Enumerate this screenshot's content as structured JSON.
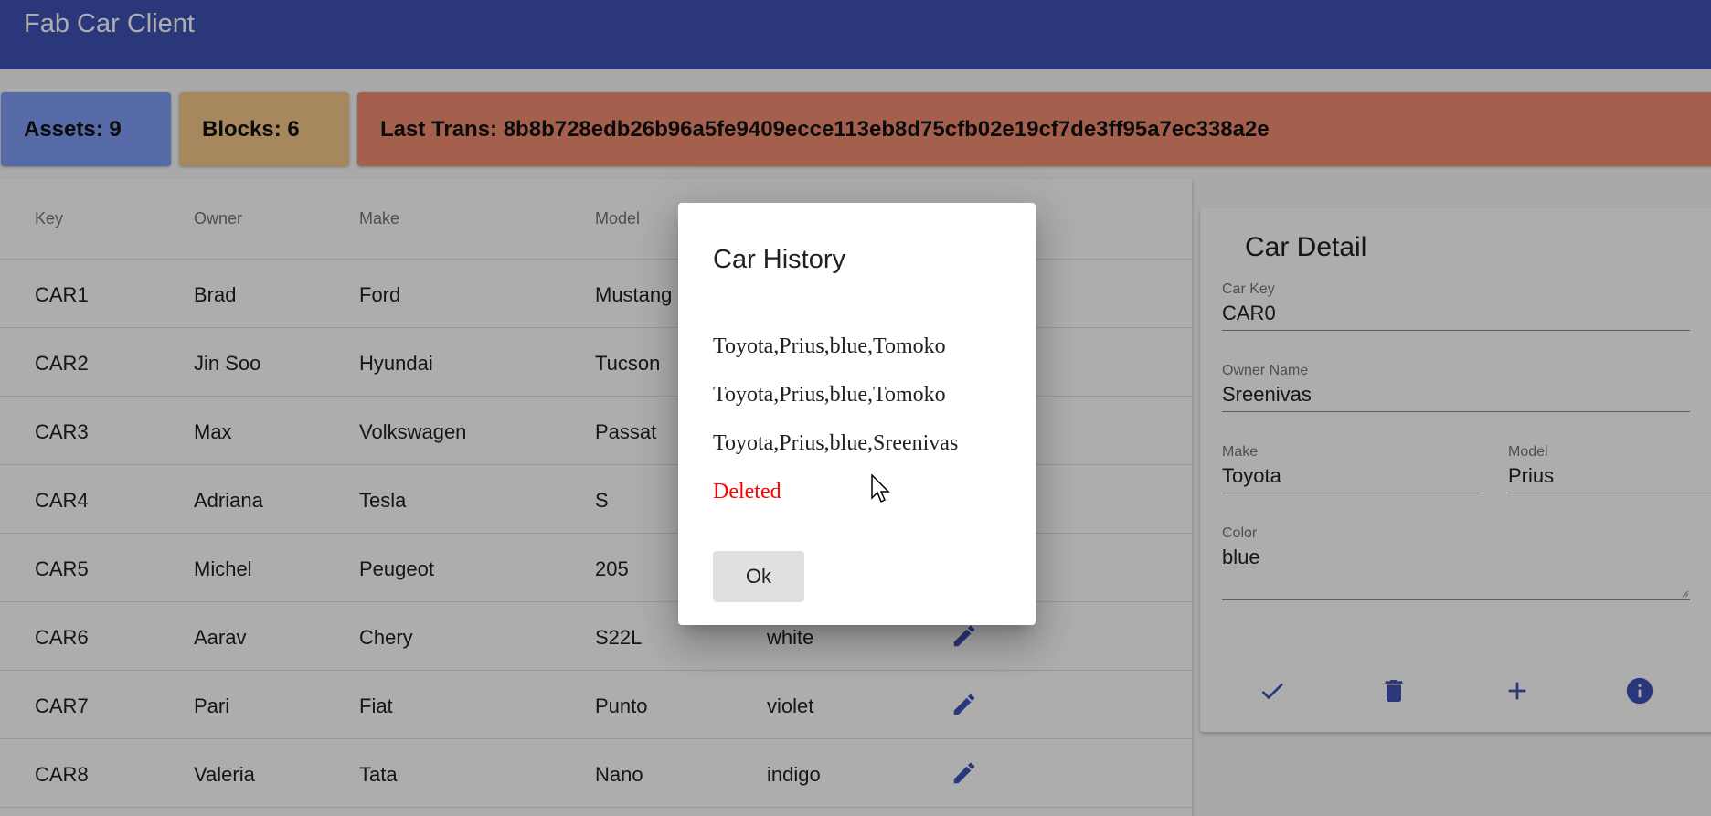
{
  "app": {
    "title": "Fab Car Client"
  },
  "stats": {
    "assets": "Assets: 9",
    "blocks": "Blocks: 6",
    "last_trans": "Last Trans: 8b8b728edb26b96a5fe9409ecce113eb8d75cfb02e19cf7de3ff95a7ec338a2e"
  },
  "table": {
    "headers": [
      "Key",
      "Owner",
      "Make",
      "Model"
    ],
    "rows": [
      {
        "key": "CAR1",
        "owner": "Brad",
        "make": "Ford",
        "model": "Mustang",
        "color": ""
      },
      {
        "key": "CAR2",
        "owner": "Jin Soo",
        "make": "Hyundai",
        "model": "Tucson",
        "color": ""
      },
      {
        "key": "CAR3",
        "owner": "Max",
        "make": "Volkswagen",
        "model": "Passat",
        "color": ""
      },
      {
        "key": "CAR4",
        "owner": "Adriana",
        "make": "Tesla",
        "model": "S",
        "color": ""
      },
      {
        "key": "CAR5",
        "owner": "Michel",
        "make": "Peugeot",
        "model": "205",
        "color": ""
      },
      {
        "key": "CAR6",
        "owner": "Aarav",
        "make": "Chery",
        "model": "S22L",
        "color": "white"
      },
      {
        "key": "CAR7",
        "owner": "Pari",
        "make": "Fiat",
        "model": "Punto",
        "color": "violet"
      },
      {
        "key": "CAR8",
        "owner": "Valeria",
        "make": "Tata",
        "model": "Nano",
        "color": "indigo"
      }
    ],
    "edit_icon": "pencil-icon"
  },
  "detail": {
    "title": "Car Detail",
    "car_key_label": "Car Key",
    "car_key_value": "CAR0",
    "owner_label": "Owner Name",
    "owner_value": "Sreenivas",
    "make_label": "Make",
    "make_value": "Toyota",
    "model_label": "Model",
    "model_value": "Prius",
    "color_label": "Color",
    "color_value": "blue",
    "actions": [
      "check-icon",
      "delete-icon",
      "plus-icon",
      "info-icon"
    ]
  },
  "dialog": {
    "title": "Car History",
    "history": [
      "Toyota,Prius,blue,Tomoko",
      "Toyota,Prius,blue,Tomoko",
      "Toyota,Prius,blue,Sreenivas"
    ],
    "deleted": "Deleted",
    "ok_label": "Ok"
  },
  "colors": {
    "primary": "#3f51b5",
    "assets_bg": "#7e9cf5",
    "blocks_bg": "#f7c88a",
    "trans_bg": "#f28d72",
    "deleted_text": "#ff0000"
  }
}
